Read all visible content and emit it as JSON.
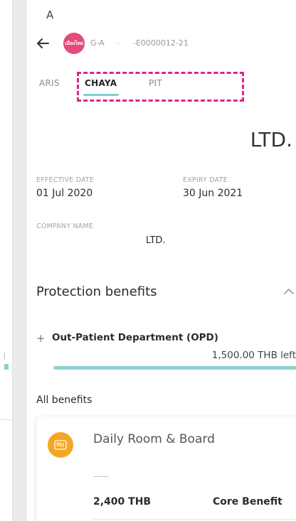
{
  "header": {
    "top_letter": "A",
    "policy_group": "G-A",
    "policy_separator": "-",
    "policy_number": "-E0000012-21",
    "logo_text": "เมืองไทย"
  },
  "tabs": [
    {
      "label": "ARIS",
      "active": false
    },
    {
      "label": "CHAYA",
      "active": true
    },
    {
      "label": "PIT",
      "active": false
    }
  ],
  "company": {
    "title": "LTD."
  },
  "fields": {
    "effective_date_label": "EFFECTIVE DATE",
    "effective_date": "01 Jul 2020",
    "expiry_date_label": "EXPIRY DATE",
    "expiry_date": "30 Jun 2021",
    "company_name_label": "COMPANY NAME",
    "company_name": "LTD."
  },
  "protection": {
    "title": "Protection benefits",
    "opd": {
      "label": "Out-Patient Department (OPD)",
      "remaining": "1,500.00 THB left",
      "progress_fraction": 1.0
    }
  },
  "all_benefits": {
    "title": "All benefits",
    "cards": [
      {
        "title": "Daily Room & Board",
        "amount": "2,400 THB",
        "type": "Core Benefit",
        "icon": "bed-icon"
      }
    ]
  },
  "colors": {
    "accent": "#7fd0cc",
    "highlight": "#e0248a",
    "logo": "#e44a7a",
    "benefit_icon": "#f5a623"
  }
}
